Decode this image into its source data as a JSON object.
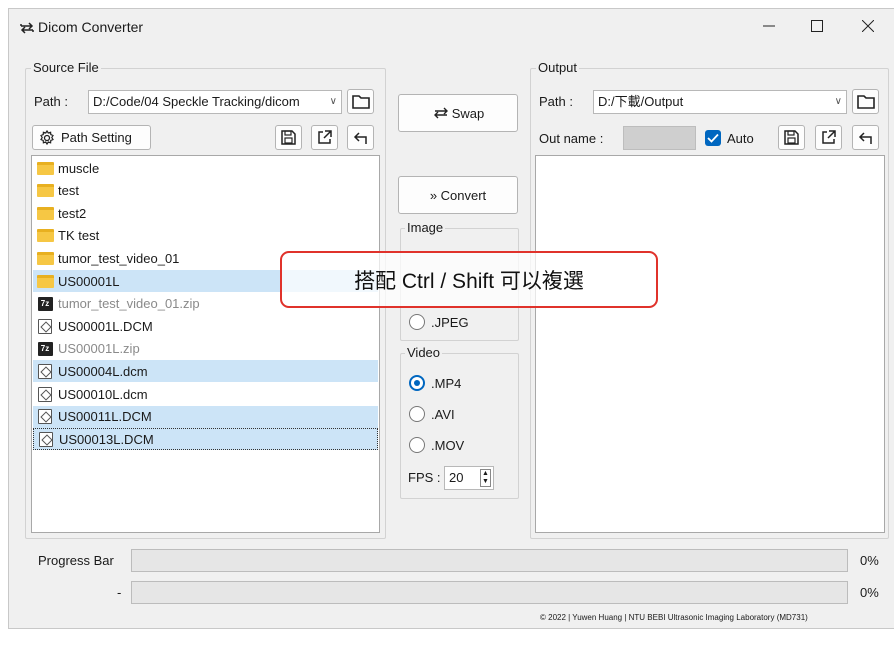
{
  "window": {
    "title": "Dicom Converter"
  },
  "source": {
    "group_label": "Source File",
    "path_label": "Path :",
    "path_value": "D:/Code/04 Speckle Tracking/dicom",
    "path_setting_label": "Path Setting",
    "files": [
      {
        "name": "muscle",
        "icon": "folder",
        "selected": false,
        "gray": false
      },
      {
        "name": "test",
        "icon": "folder",
        "selected": false,
        "gray": false
      },
      {
        "name": "test2",
        "icon": "folder",
        "selected": false,
        "gray": false
      },
      {
        "name": "TK test",
        "icon": "folder",
        "selected": false,
        "gray": false
      },
      {
        "name": "tumor_test_video_01",
        "icon": "folder",
        "selected": false,
        "gray": false
      },
      {
        "name": "US00001L",
        "icon": "folder",
        "selected": true,
        "gray": false
      },
      {
        "name": "tumor_test_video_01.zip",
        "icon": "zip",
        "selected": false,
        "gray": true
      },
      {
        "name": "US00001L.DCM",
        "icon": "dicom-file",
        "selected": false,
        "gray": false
      },
      {
        "name": "US00001L.zip",
        "icon": "zip",
        "selected": false,
        "gray": true
      },
      {
        "name": "US00004L.dcm",
        "icon": "dicom-file",
        "selected": true,
        "gray": false
      },
      {
        "name": "US00010L.dcm",
        "icon": "dicom-file",
        "selected": false,
        "gray": false
      },
      {
        "name": "US00011L.DCM",
        "icon": "dicom-file",
        "selected": true,
        "gray": false
      },
      {
        "name": "US00013L.DCM",
        "icon": "dicom-file",
        "selected": true,
        "gray": false,
        "focused": true
      }
    ]
  },
  "middle": {
    "swap_label": "Swap",
    "convert_label": "» Convert",
    "image_group_label": "Image",
    "image_formats": [
      ".JPEG"
    ],
    "video_group_label": "Video",
    "video_formats": [
      {
        "label": ".MP4",
        "selected": true
      },
      {
        "label": ".AVI",
        "selected": false
      },
      {
        "label": ".MOV",
        "selected": false
      }
    ],
    "fps_label": "FPS :",
    "fps_value": "20"
  },
  "output": {
    "group_label": "Output",
    "path_label": "Path :",
    "path_value": "D:/下載/Output",
    "out_name_label": "Out name :",
    "out_name_value": "",
    "auto_label": "Auto",
    "auto_checked": true
  },
  "progress": {
    "label": "Progress Bar",
    "value_text": "0%",
    "value": 0,
    "sub_label": "-",
    "sub_value_text": "0%",
    "sub_value": 0
  },
  "footer": {
    "copyright": "© 2022 | Yuwen Huang | NTU BEBI Ultrasonic Imaging Laboratory (MD731)"
  },
  "tooltip": {
    "text": "搭配 Ctrl / Shift 可以複選"
  },
  "colors": {
    "accent": "#0067c0",
    "selection": "#cce4f7",
    "tooltip_border": "#e0322b"
  }
}
